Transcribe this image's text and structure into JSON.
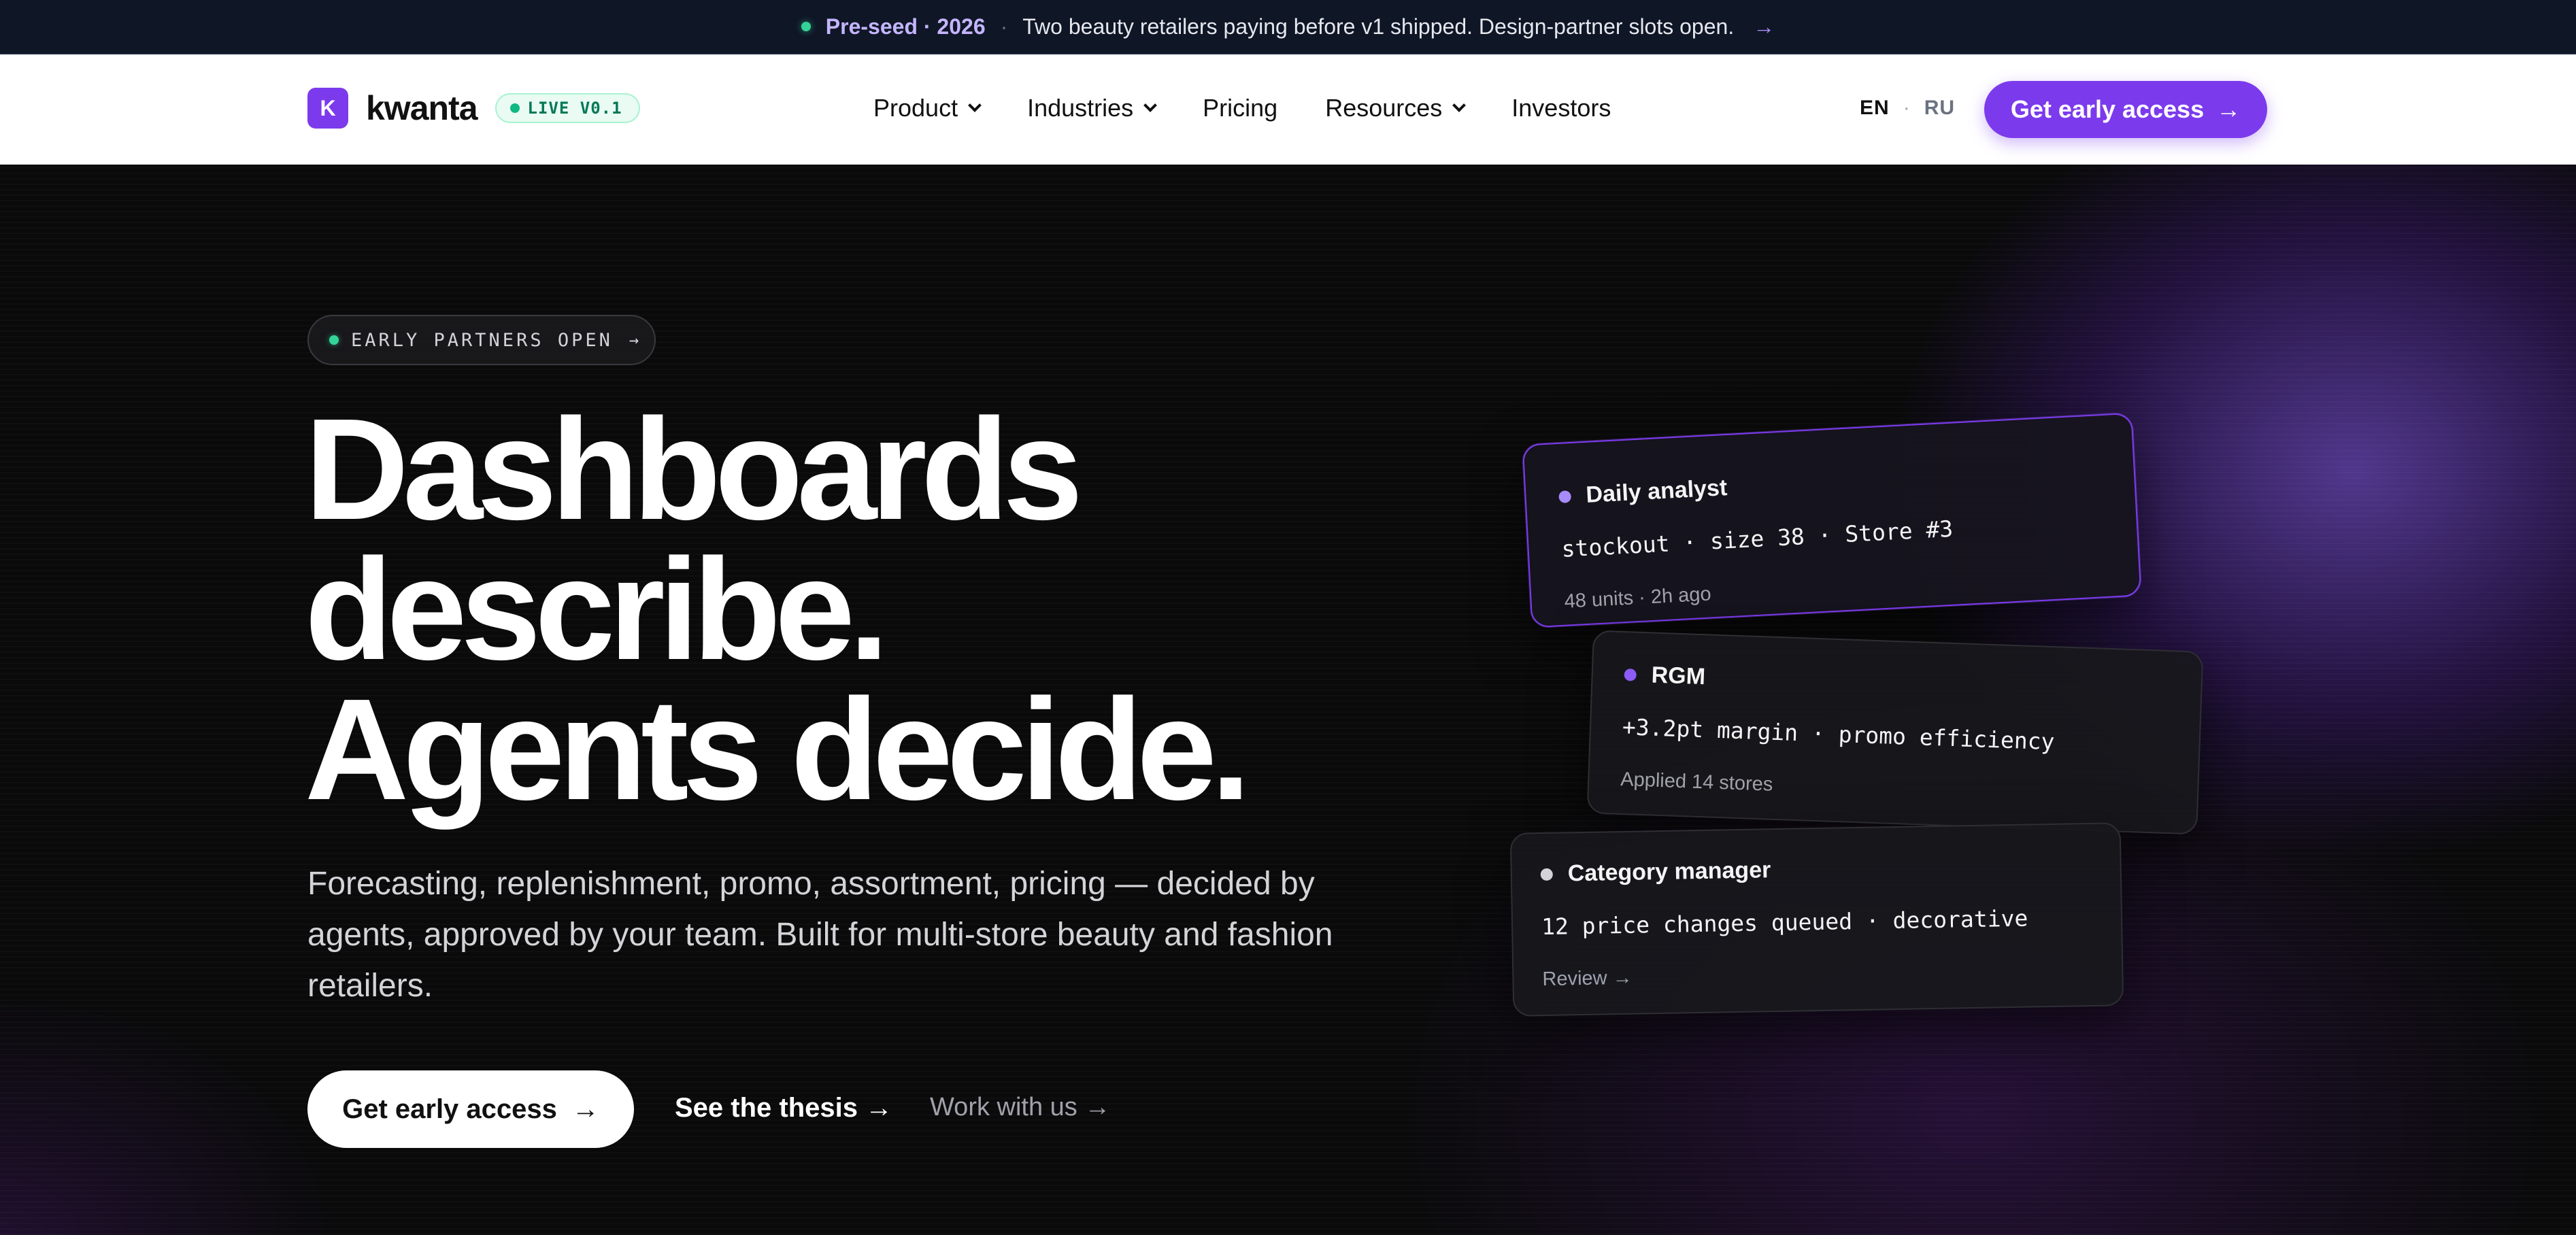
{
  "announcement": {
    "stage": "Pre-seed · 2026",
    "separator": "·",
    "message": "Two beauty retailers paying before v1 shipped. Design-partner slots open.",
    "arrow": "→"
  },
  "nav": {
    "logo_letter": "K",
    "brand": "kwanta",
    "live_badge": "LIVE V0.1",
    "menu": [
      {
        "label": "Product",
        "has_dropdown": true
      },
      {
        "label": "Industries",
        "has_dropdown": true
      },
      {
        "label": "Pricing",
        "has_dropdown": false
      },
      {
        "label": "Resources",
        "has_dropdown": true
      },
      {
        "label": "Investors",
        "has_dropdown": false
      }
    ],
    "lang_en": "EN",
    "lang_sep": "·",
    "lang_ru": "RU",
    "cta_label": "Get early access",
    "cta_arrow": "→"
  },
  "hero": {
    "badge": "EARLY PARTNERS OPEN",
    "badge_arrow": "→",
    "headline_lines": [
      "Dashboards",
      "describe.",
      "Agents decide."
    ],
    "subcopy": "Forecasting, replenishment, promo, assortment, pricing — decided by agents, approved by your team. Built for multi-store beauty and fashion retailers.",
    "cta_primary": "Get early access",
    "cta_primary_arrow": "→",
    "cta_thesis": "See the thesis →",
    "cta_work": "Work with us →"
  },
  "cards": [
    {
      "title": "Daily analyst",
      "detail": "stockout · size 38 · Store #3",
      "meta": "48 units · 2h ago",
      "dot_color": "#a78bfa"
    },
    {
      "title": "RGM",
      "detail": "+3.2pt margin · promo efficiency",
      "meta": "Applied 14 stores",
      "dot_color": "#8b5cf6"
    },
    {
      "title": "Category manager",
      "detail": "12 price changes queued · decorative",
      "meta": "Review →",
      "dot_color": "#d4d4d8"
    }
  ],
  "colors": {
    "accent": "#7c3aed",
    "live_green": "#10b981",
    "announce_bg": "#0f1626",
    "hero_bg": "#0a0a0b"
  }
}
